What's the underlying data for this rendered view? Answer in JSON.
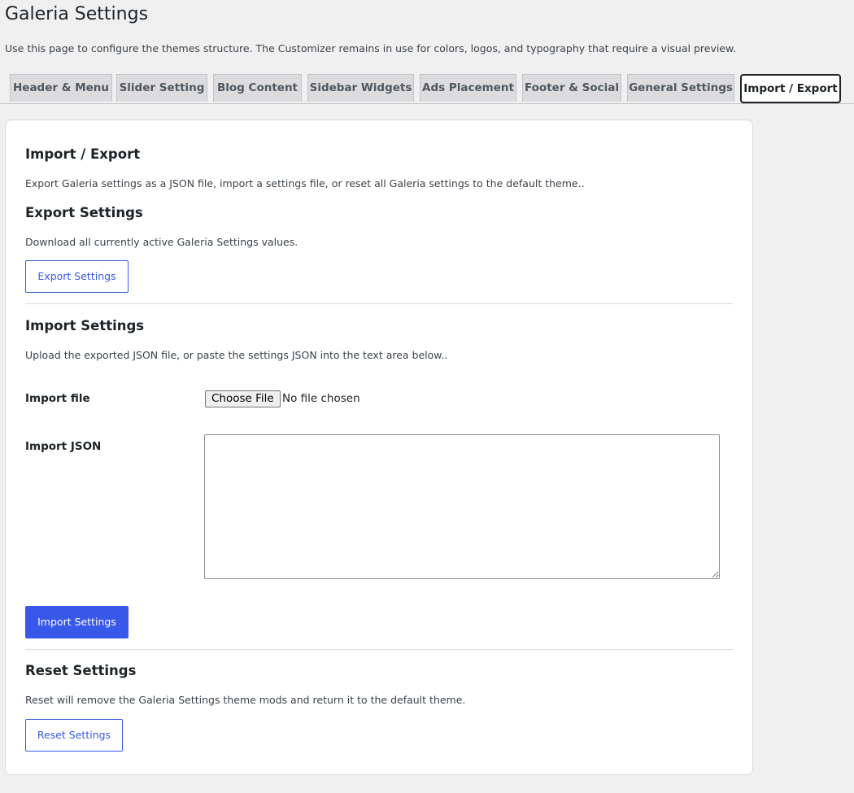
{
  "page": {
    "title": "Galeria Settings",
    "description": "Use this page to configure the themes structure. The Customizer remains in use for colors, logos, and typography that require a visual preview."
  },
  "tabs": [
    {
      "label": "Header & Menu"
    },
    {
      "label": "Slider Setting"
    },
    {
      "label": "Blog Content"
    },
    {
      "label": "Sidebar Widgets"
    },
    {
      "label": "Ads Placement"
    },
    {
      "label": "Footer & Social"
    },
    {
      "label": "General Settings"
    },
    {
      "label": "Import / Export",
      "active": true
    }
  ],
  "main": {
    "title": "Import / Export",
    "description": "Export Galeria settings as a JSON file, import a settings file, or reset all Galeria settings to the default theme..",
    "export": {
      "title": "Export Settings",
      "description": "Download all currently active Galeria Settings values.",
      "button": "Export Settings"
    },
    "import": {
      "title": "Import Settings",
      "description": "Upload the exported JSON file, or paste the settings JSON into the text area below..",
      "file_label": "Import file",
      "file_button": "Choose File",
      "file_status": "No file chosen",
      "json_label": "Import JSON",
      "json_value": "",
      "button": "Import Settings"
    },
    "reset": {
      "title": "Reset Settings",
      "description": "Reset will remove the Galeria Settings theme mods and return it to the default theme.",
      "button": "Reset Settings"
    }
  },
  "colors": {
    "accent": "#3858e9",
    "background": "#f0f0f1",
    "card": "#ffffff",
    "tab_inactive": "#dcdcde",
    "tab_active_border": "#1d2327"
  }
}
